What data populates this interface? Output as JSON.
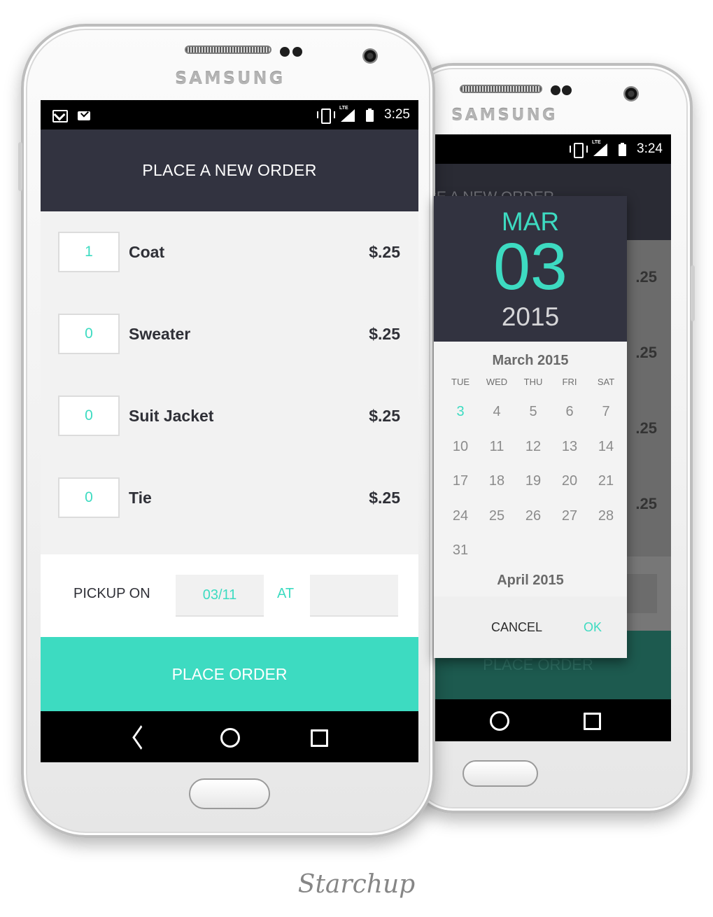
{
  "back_phone": {
    "brand": "SAMSUNG",
    "status_time": "3:24",
    "header_title": "PLACE A NEW ORDER",
    "prices": [
      ".25",
      ".25",
      ".25",
      ".25"
    ],
    "place_order_label": "PLACE ORDER",
    "date_picker": {
      "month": "MAR",
      "day": "03",
      "year": "2015",
      "month_caption": "March 2015",
      "weekdays": [
        "TUE",
        "WED",
        "THU",
        "FRI",
        "SAT"
      ],
      "weeks": [
        [
          "3",
          "4",
          "5",
          "6",
          "7"
        ],
        [
          "10",
          "11",
          "12",
          "13",
          "14"
        ],
        [
          "17",
          "18",
          "19",
          "20",
          "21"
        ],
        [
          "24",
          "25",
          "26",
          "27",
          "28"
        ],
        [
          "31",
          "",
          "",
          "",
          ""
        ]
      ],
      "next_month_caption": "April 2015",
      "cancel_label": "CANCEL",
      "ok_label": "OK",
      "accent_color": "#3ddbc1"
    }
  },
  "front_phone": {
    "brand": "SAMSUNG",
    "status_time": "3:25",
    "header_title": "PLACE A NEW ORDER",
    "items": [
      {
        "qty": "1",
        "name": "Coat",
        "price": "$.25"
      },
      {
        "qty": "0",
        "name": "Sweater",
        "price": "$.25"
      },
      {
        "qty": "0",
        "name": "Suit Jacket",
        "price": "$.25"
      },
      {
        "qty": "0",
        "name": "Tie",
        "price": "$.25"
      }
    ],
    "pickup_label": "PICKUP ON",
    "pickup_date": "03/11",
    "pickup_at_label": "AT",
    "pickup_time": "",
    "place_order_label": "PLACE ORDER",
    "accent_color": "#3ddbc1",
    "header_color": "#323340"
  },
  "caption": "Starchup"
}
